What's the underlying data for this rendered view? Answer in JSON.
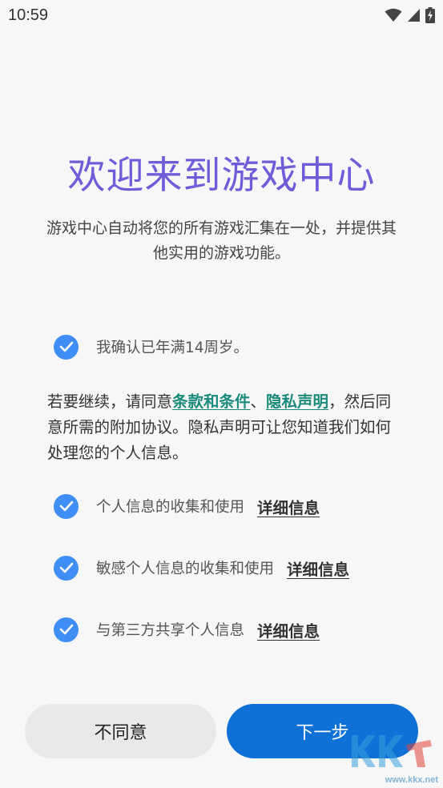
{
  "status_bar": {
    "time": "10:59"
  },
  "header": {
    "title": "欢迎来到游戏中心",
    "subtitle": "游戏中心自动将您的所有游戏汇集在一处，并提供其他实用的游戏功能。"
  },
  "age_check": {
    "label": "我确认已年满14周岁。",
    "checked": true
  },
  "consent": {
    "prefix": "若要继续，请同意",
    "terms_link": "条款和条件",
    "separator": "、",
    "privacy_link": "隐私声明",
    "suffix": "，然后同意所需的附加协议。隐私声明可让您知道我们如何处理您的个人信息。"
  },
  "agreements": [
    {
      "label": "个人信息的收集和使用",
      "detail": "详细信息",
      "checked": true
    },
    {
      "label": "敏感个人信息的收集和使用",
      "detail": "详细信息",
      "checked": true
    },
    {
      "label": "与第三方共享个人信息",
      "detail": "详细信息",
      "checked": true
    }
  ],
  "buttons": {
    "disagree": "不同意",
    "next": "下一步"
  },
  "watermark": {
    "text": "www.kkx.net"
  },
  "colors": {
    "title": "#6f5cd9",
    "checkbox": "#3f8ef6",
    "link": "#1a8a7a",
    "primary_button": "#0f70d6",
    "secondary_button": "#e9e9e9",
    "background": "#f7f7f7"
  },
  "icons": {
    "status": [
      "wifi-icon",
      "cellular-signal-icon",
      "battery-charging-icon"
    ],
    "checkbox": "check-circle-icon"
  }
}
